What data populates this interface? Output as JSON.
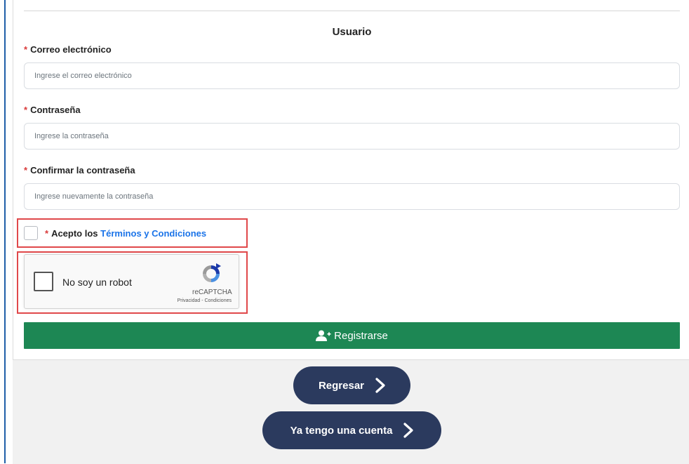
{
  "section": {
    "title": "Usuario"
  },
  "required_mark": "*",
  "fields": {
    "email": {
      "label": "Correo electrónico",
      "placeholder": "Ingrese el correo electrónico",
      "value": ""
    },
    "password": {
      "label": "Contraseña",
      "placeholder": "Ingrese la contraseña",
      "value": ""
    },
    "confirm": {
      "label": "Confirmar la contraseña",
      "placeholder": "Ingrese nuevamente la contraseña",
      "value": ""
    }
  },
  "terms": {
    "prefix": "Acepto los",
    "link": "Términos y Condiciones",
    "checked": false
  },
  "captcha": {
    "label": "No soy un robot",
    "brand": "reCAPTCHA",
    "links": "Privacidad - Condiciones"
  },
  "buttons": {
    "register": "Registrarse",
    "back": "Regresar",
    "have_account": "Ya tengo una cuenta"
  },
  "icons": {
    "register": "user-plus-icon",
    "chevron": "chevron-right-icon",
    "captcha_logo": "recaptcha-logo-icon"
  },
  "colors": {
    "required": "#d93a3a",
    "link": "#1a73e8",
    "register_bg": "#1d8754",
    "pill_bg": "#2b3a5e",
    "highlight_border": "#e0484a",
    "footer_bg": "#f1f1f1"
  }
}
